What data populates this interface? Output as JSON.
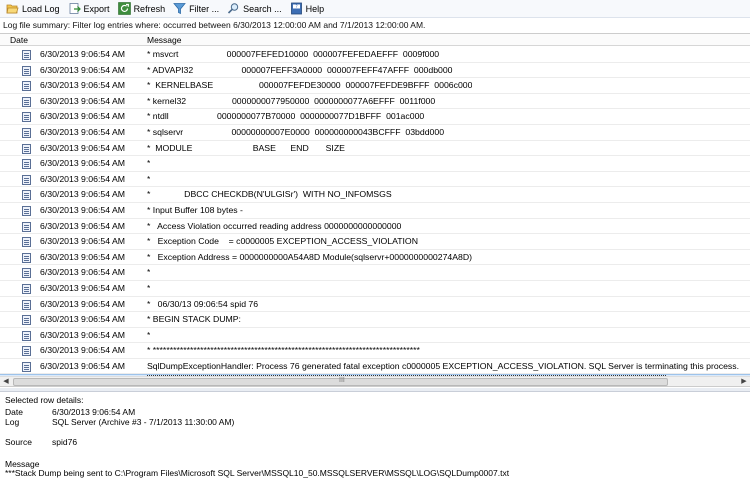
{
  "toolbar": {
    "load_log": "Load Log",
    "export": "Export",
    "refresh": "Refresh",
    "filter": "Filter ...",
    "search": "Search ...",
    "help": "Help"
  },
  "summary": "Log file summary: Filter log entries where: occurred between 6/30/2013 12:00:00 AM and 7/1/2013 12:00:00 AM.",
  "grid": {
    "columns": {
      "date": "Date",
      "message": "Message"
    },
    "rows": [
      {
        "date": "6/30/2013 9:06:54 AM",
        "message": "* msvcrt                    000007FEFED10000  000007FEFEDAEFFF  0009f000"
      },
      {
        "date": "6/30/2013 9:06:54 AM",
        "message": "* ADVAPI32                    000007FEFF3A0000  000007FEFF47AFFF  000db000"
      },
      {
        "date": "6/30/2013 9:06:54 AM",
        "message": "*  KERNELBASE                   000007FEFDE30000  000007FEFDE9BFFF  0006c000"
      },
      {
        "date": "6/30/2013 9:06:54 AM",
        "message": "* kernel32                   0000000077950000  0000000077A6EFFF  0011f000"
      },
      {
        "date": "6/30/2013 9:06:54 AM",
        "message": "* ntdll                    0000000077B70000  0000000077D1BFFF  001ac000"
      },
      {
        "date": "6/30/2013 9:06:54 AM",
        "message": "* sqlservr                    00000000007E0000  000000000043BCFFF  03bdd000"
      },
      {
        "date": "6/30/2013 9:06:54 AM",
        "message": "*  MODULE                         BASE      END       SIZE"
      },
      {
        "date": "6/30/2013 9:06:54 AM",
        "message": "*"
      },
      {
        "date": "6/30/2013 9:06:54 AM",
        "message": "*"
      },
      {
        "date": "6/30/2013 9:06:54 AM",
        "message": "*              DBCC CHECKDB(N'ULGISr')  WITH NO_INFOMSGS"
      },
      {
        "date": "6/30/2013 9:06:54 AM",
        "message": "* Input Buffer 108 bytes -"
      },
      {
        "date": "6/30/2013 9:06:54 AM",
        "message": "*   Access Violation occurred reading address 0000000000000000"
      },
      {
        "date": "6/30/2013 9:06:54 AM",
        "message": "*   Exception Code    = c0000005 EXCEPTION_ACCESS_VIOLATION"
      },
      {
        "date": "6/30/2013 9:06:54 AM",
        "message": "*   Exception Address = 0000000000A54A8D Module(sqlservr+0000000000274A8D)"
      },
      {
        "date": "6/30/2013 9:06:54 AM",
        "message": "*"
      },
      {
        "date": "6/30/2013 9:06:54 AM",
        "message": "*"
      },
      {
        "date": "6/30/2013 9:06:54 AM",
        "message": "*   06/30/13 09:06:54 spid 76"
      },
      {
        "date": "6/30/2013 9:06:54 AM",
        "message": "* BEGIN STACK DUMP:"
      },
      {
        "date": "6/30/2013 9:06:54 AM",
        "message": "*"
      },
      {
        "date": "6/30/2013 9:06:54 AM",
        "message": "* *******************************************************************************"
      },
      {
        "date": "6/30/2013 9:06:54 AM",
        "message": "SqlDumpExceptionHandler: Process 76 generated fatal exception c0000005 EXCEPTION_ACCESS_VIOLATION. SQL Server is terminating this process."
      },
      {
        "date": "6/30/2013 9:06:54 AM",
        "message": "***Stack Dump being sent to C:\\Program Files\\Microsoft SQL Server\\MSSQL10_50.MSSQLSERVER\\MSSQL\\LOG\\SQLDump0007.txt"
      }
    ],
    "scroll_grip": "III"
  },
  "details": {
    "title": "Selected row details:",
    "date_label": "Date",
    "date_value": "6/30/2013 9:06:54 AM",
    "log_label": "Log",
    "log_value": "SQL Server (Archive #3 - 7/1/2013 11:30:00 AM)",
    "source_label": "Source",
    "source_value": "spid76",
    "message_label": "Message",
    "message_value": "***Stack Dump being sent to C:\\Program Files\\Microsoft SQL Server\\MSSQL10_50.MSSQLSERVER\\MSSQL\\LOG\\SQLDump0007.txt"
  }
}
